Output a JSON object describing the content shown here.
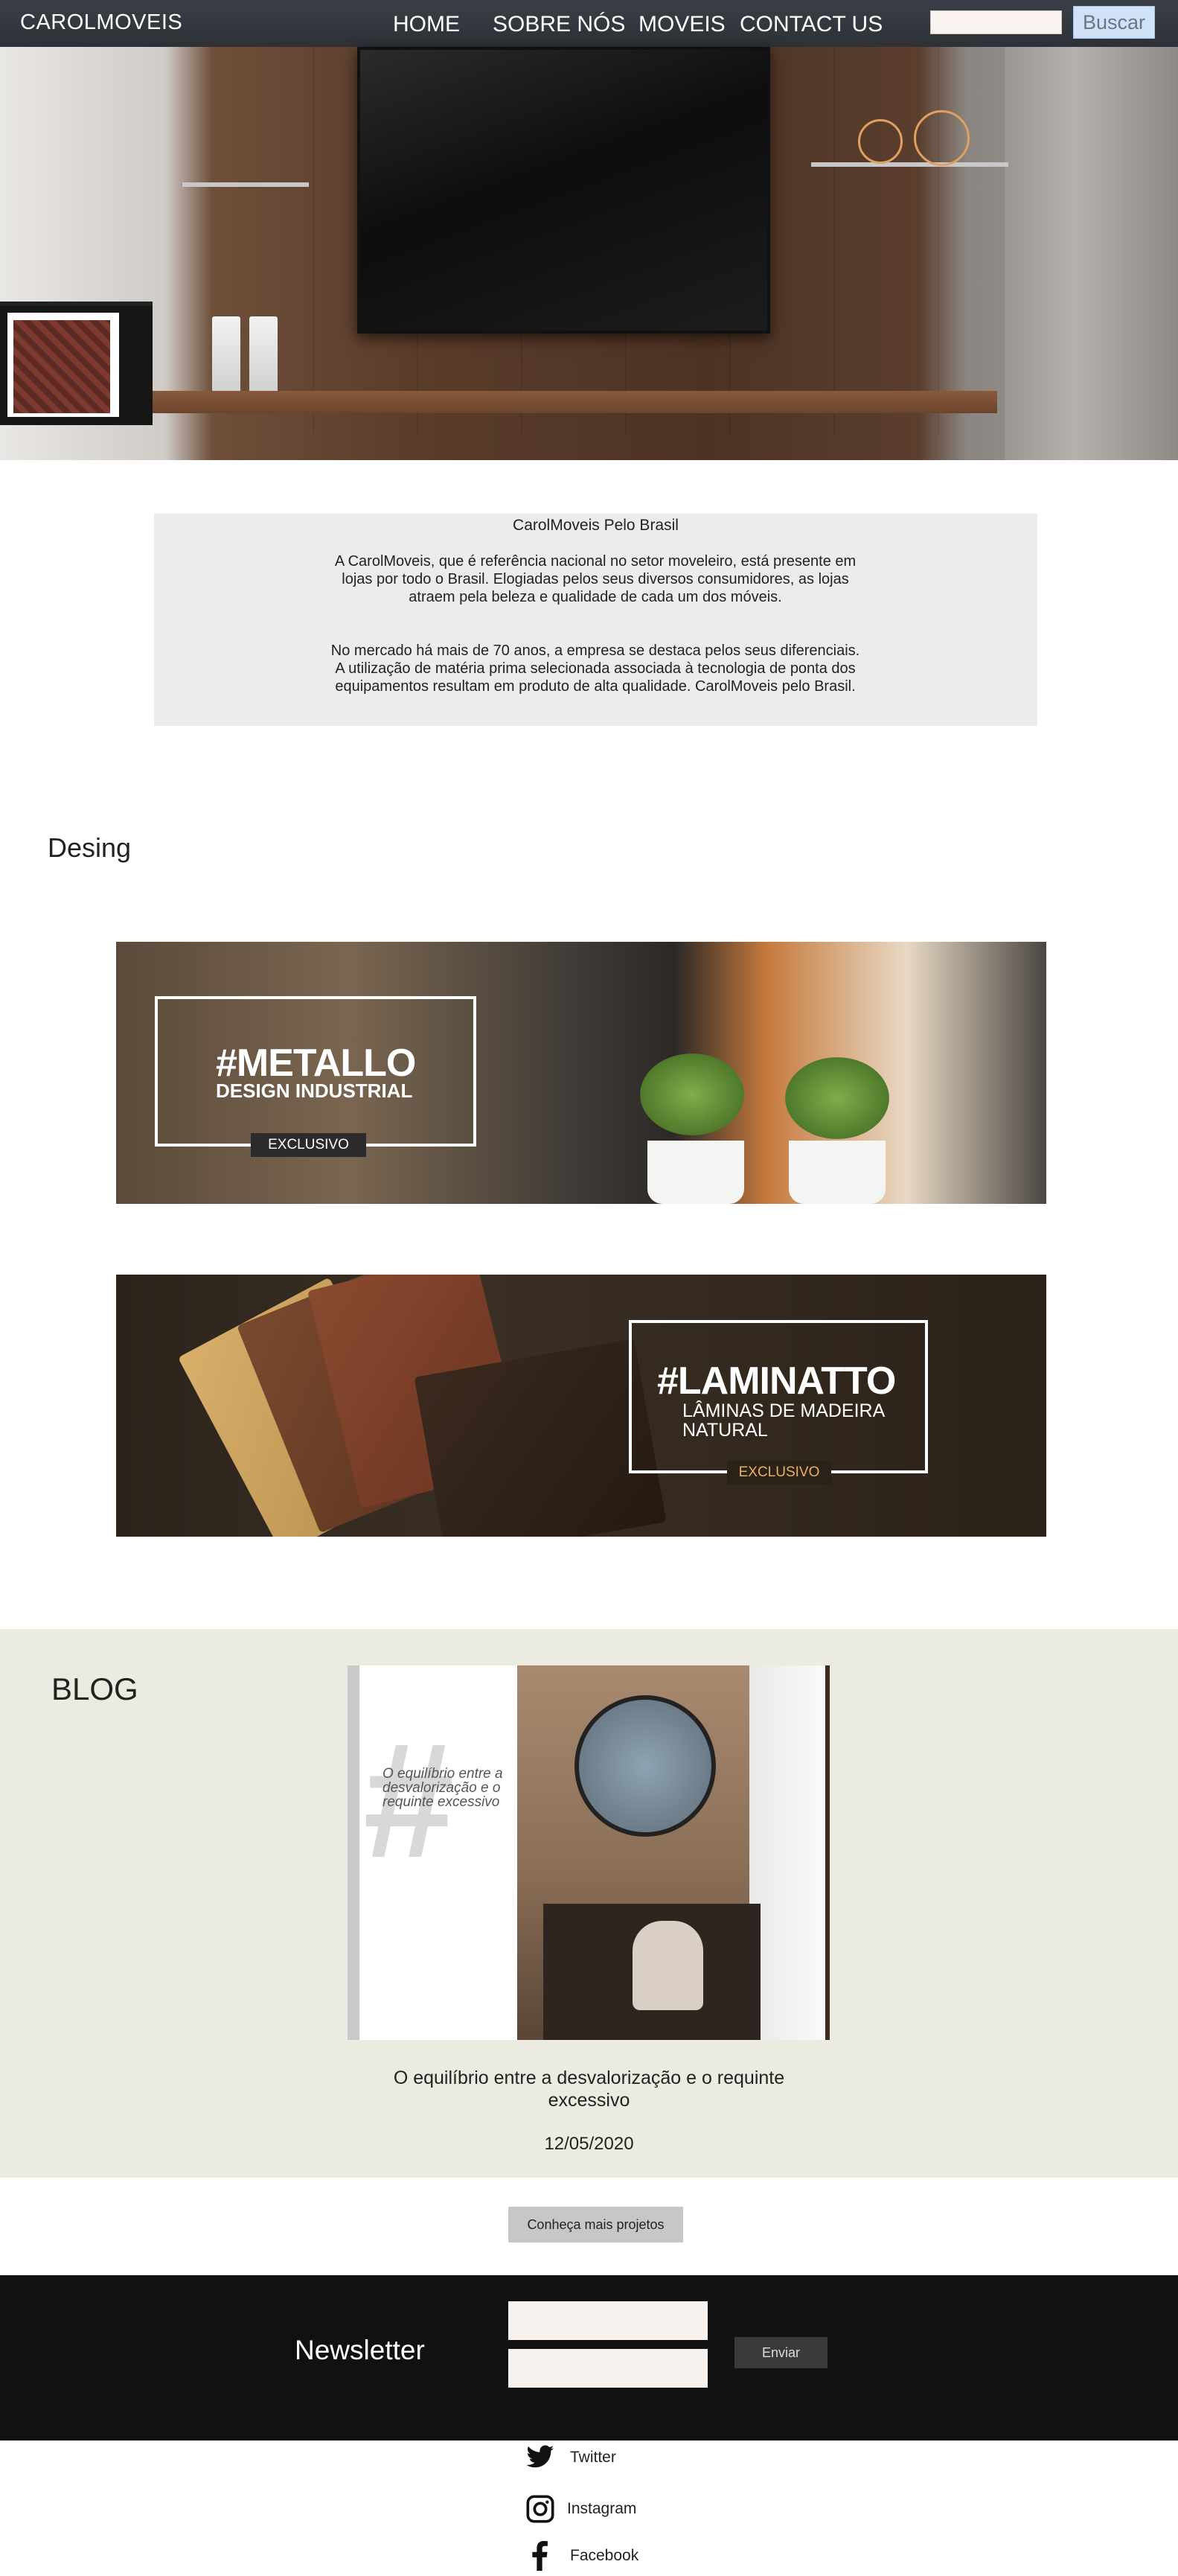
{
  "navbar": {
    "brand": "CAROLMOVEIS",
    "links": [
      "HOME",
      "SOBRE NÓS",
      "MOVEIS",
      "CONTACT US"
    ],
    "search_placeholder": "",
    "search_button": "Buscar"
  },
  "intro": {
    "title": "CarolMoveis Pelo Brasil",
    "paragraph1": "A CarolMoveis, que é referência nacional no setor moveleiro, está presente em lojas por todo o Brasil. Elogiadas pelos seus diversos consumidores, as lojas atraem pela beleza e qualidade de cada um dos móveis.",
    "paragraph2": "No mercado há mais de 70 anos, a empresa se destaca pelos seus diferenciais. A utilização de matéria prima selecionada associada à tecnologia de ponta dos equipamentos resultam em produto de alta qualidade. CarolMoveis pelo Brasil."
  },
  "design": {
    "heading": "Desing",
    "banners": [
      {
        "title": "#METALLO",
        "subtitle": "DESIGN INDUSTRIAL",
        "badge": "EXCLUSIVO"
      },
      {
        "title": "#LAMINATTO",
        "subtitle": "LÂMINAS DE MADEIRA NATURAL",
        "badge": "EXCLUSIVO"
      }
    ]
  },
  "blog": {
    "heading": "BLOG",
    "image_text": "O equilíbrio entre a desvalorização e o requinte excessivo",
    "post_title": "O equilíbrio entre a desvalorização e o requinte excessivo",
    "post_date": "12/05/2020"
  },
  "projects_button": "Conheça mais projetos",
  "newsletter": {
    "label": "Newsletter",
    "input1_placeholder": "",
    "input2_placeholder": "",
    "button": "Enviar"
  },
  "social": [
    {
      "icon": "twitter-icon",
      "label": "Twitter"
    },
    {
      "icon": "instagram-icon",
      "label": "Instagram"
    },
    {
      "icon": "facebook-icon",
      "label": "Facebook"
    }
  ],
  "colors": {
    "navbar": "#33373d",
    "search_button": "#cfe2f7",
    "intro_bg": "#ececec",
    "blog_bg": "#ecebe1",
    "newsletter_bg": "#111111",
    "projects_button": "#c7c7c7"
  }
}
